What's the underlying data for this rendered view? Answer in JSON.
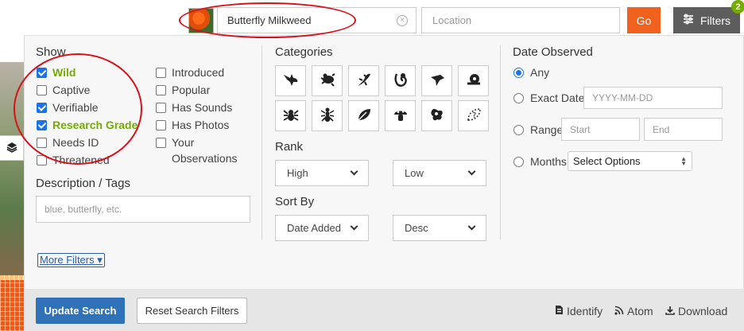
{
  "search": {
    "taxon_value": "Butterfly Milkweed",
    "location_placeholder": "Location",
    "go_label": "Go",
    "filters_label": "Filters",
    "filters_count": "2"
  },
  "show": {
    "title": "Show",
    "left": [
      {
        "label": "Wild",
        "checked": true
      },
      {
        "label": "Captive",
        "checked": false
      },
      {
        "label": "Verifiable",
        "checked": true
      },
      {
        "label": "Research Grade",
        "checked": true
      },
      {
        "label": "Needs ID",
        "checked": false
      },
      {
        "label": "Threatened",
        "checked": false
      }
    ],
    "right": [
      {
        "label": "Introduced",
        "checked": false
      },
      {
        "label": "Popular",
        "checked": false
      },
      {
        "label": "Has Sounds",
        "checked": false
      },
      {
        "label": "Has Photos",
        "checked": false
      },
      {
        "label": "Your Observations",
        "checked": false
      }
    ]
  },
  "description": {
    "title": "Description / Tags",
    "placeholder": "blue, butterfly, etc."
  },
  "more_filters_label": "More Filters",
  "categories": {
    "title": "Categories",
    "icons": [
      "bird-icon",
      "amphibian-icon",
      "reptile-icon",
      "mammal-icon",
      "fish-icon",
      "mollusk-icon",
      "arachnid-icon",
      "insect-icon",
      "plant-icon",
      "fungi-icon",
      "protozoa-icon",
      "unknown-icon"
    ]
  },
  "rank": {
    "title": "Rank",
    "high": "High",
    "low": "Low"
  },
  "sort": {
    "title": "Sort By",
    "field": "Date Added",
    "order": "Desc"
  },
  "date": {
    "title": "Date Observed",
    "any": "Any",
    "exact": "Exact Date",
    "exact_placeholder": "YYYY-MM-DD",
    "range": "Range",
    "start_placeholder": "Start",
    "end_placeholder": "End",
    "months": "Months",
    "months_select": "Select Options"
  },
  "footer": {
    "update": "Update Search",
    "reset": "Reset Search Filters",
    "identify": "Identify",
    "atom": "Atom",
    "download": "Download"
  },
  "colors": {
    "accent_green": "#74ac00",
    "go_orange": "#f0611e",
    "primary_blue": "#2f72b7",
    "annotation_red": "#d9101a"
  }
}
